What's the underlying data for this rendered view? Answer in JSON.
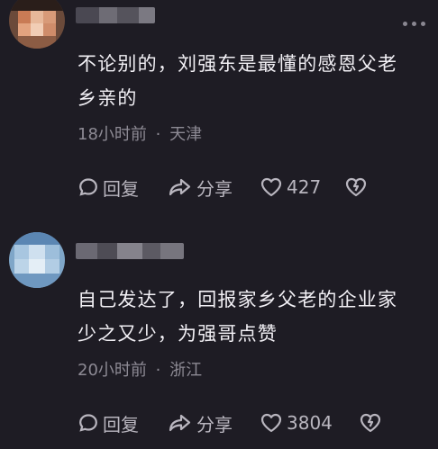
{
  "comments": [
    {
      "text": "不论别的，刘强东是最懂的感恩父老乡亲的",
      "time": "18小时前",
      "separator": "·",
      "location": "天津",
      "reply_label": "回复",
      "share_label": "分享",
      "likes": "427"
    },
    {
      "text": "自己发达了，回报家乡父老的企业家少之又少，为强哥点赞",
      "time": "20小时前",
      "separator": "·",
      "location": "浙江",
      "reply_label": "回复",
      "share_label": "分享",
      "likes": "3804"
    }
  ],
  "icons": {
    "reply": "speech-bubble-icon",
    "share": "share-arrow-icon",
    "like": "heart-icon",
    "dislike": "broken-heart-icon",
    "more": "more-dots-icon"
  },
  "colors": {
    "background": "#1e1c24",
    "text": "#f2f0f5",
    "meta": "#8d8a94",
    "action": "#b9b6bf"
  }
}
